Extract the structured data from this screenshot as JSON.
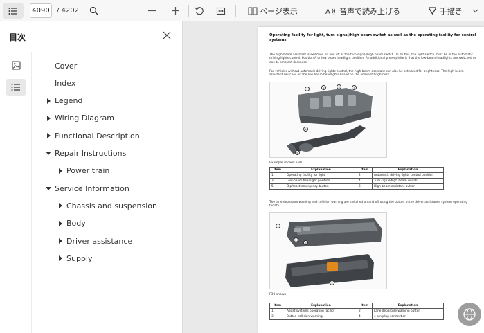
{
  "toolbar": {
    "current_page": "4090",
    "total_pages": "/ 4202",
    "page_view_label": "ページ表示",
    "read_aloud_label": "音声で読み上げる",
    "draw_label": "手描き"
  },
  "sidebar": {
    "title": "目次",
    "toc": [
      {
        "label": "Cover",
        "level": 0,
        "arrow": "none"
      },
      {
        "label": "Index",
        "level": 0,
        "arrow": "none"
      },
      {
        "label": "Legend",
        "level": 0,
        "arrow": "right"
      },
      {
        "label": "Wiring Diagram",
        "level": 0,
        "arrow": "right"
      },
      {
        "label": "Functional Description",
        "level": 0,
        "arrow": "right"
      },
      {
        "label": "Repair Instructions",
        "level": 0,
        "arrow": "down"
      },
      {
        "label": "Power train",
        "level": 1,
        "arrow": "right"
      },
      {
        "label": "Service Information",
        "level": 0,
        "arrow": "down"
      },
      {
        "label": "Chassis and suspension",
        "level": 1,
        "arrow": "right"
      },
      {
        "label": "Body",
        "level": 1,
        "arrow": "right"
      },
      {
        "label": "Driver assistance",
        "level": 1,
        "arrow": "right"
      },
      {
        "label": "Supply",
        "level": 1,
        "arrow": "right"
      }
    ]
  },
  "document": {
    "heading": "Operating facility for light, turn signal/high beam switch as well as the operating facility for control systems",
    "para1": "The high-beam assistant is switched on and off at the turn signal/high beam switch. To do this, the light switch must be in the automatic driving lights control. Position A or low beam headlight position. An additional prerequisite is that the low-beam headlights are switched on due to ambient darkness.",
    "para2": "For vehicles without automatic driving lights control, the high-beam assistant can also be activated for brightness. The high-beam assistant switches on the low beam headlights based on the ambient brightness.",
    "caption1": "Example shown: F30",
    "table1": {
      "headers": [
        "Item",
        "Explanation",
        "Item",
        "Explanation"
      ],
      "rows": [
        [
          "1",
          "Operating facility for light",
          "2",
          "Automatic driving lights control position"
        ],
        [
          "3",
          "Low-beam headlight position",
          "4",
          "Turn signal/high beam switch"
        ],
        [
          "5",
          "Dip/reset emergency button",
          "6",
          "High-beam assistant button"
        ]
      ]
    },
    "para3": "The lane departure warning and collision warning are switched on and off using the button in the driver assistance system operating facility.",
    "caption2": "F30 shown",
    "table2": {
      "headers": [
        "Item",
        "Explanation",
        "Item",
        "Explanation"
      ],
      "rows": [
        [
          "1",
          "Assist systems operating facility",
          "2",
          "Lane departure warning button"
        ],
        [
          "3",
          "Button collision warning",
          "4",
          "4-pin plug connection"
        ]
      ]
    }
  },
  "colors": {
    "toolbar_bg": "#f7f7f7",
    "doc_bg": "#e9e9e9",
    "accent_orange": "#e08a1e"
  }
}
